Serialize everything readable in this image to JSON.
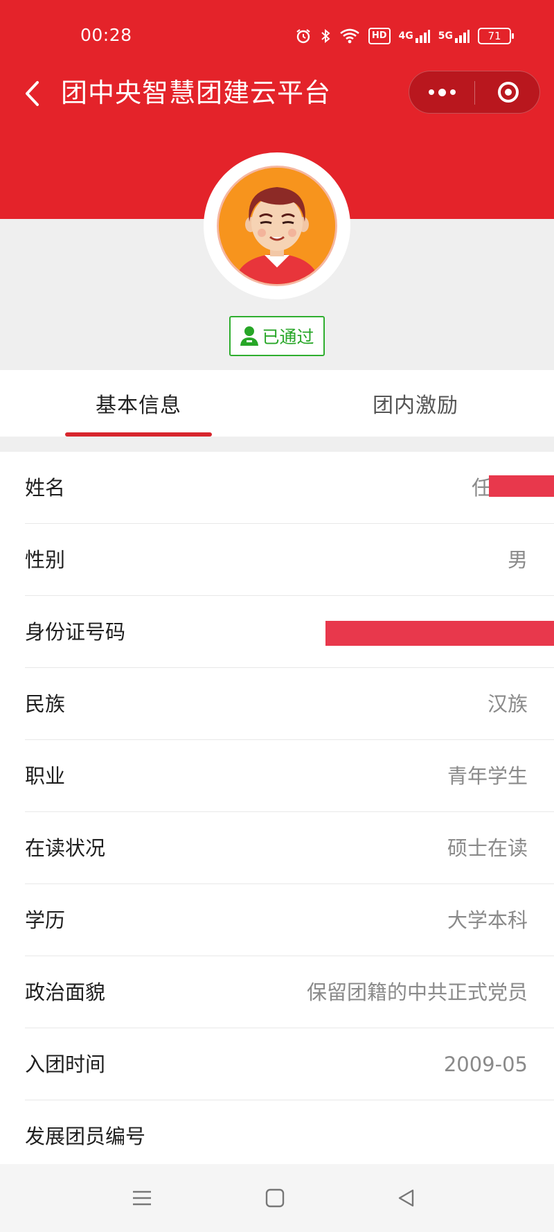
{
  "status_bar": {
    "time": "00:28",
    "hd_label": "HD",
    "network_1": "4G",
    "network_2": "5G",
    "battery": "71"
  },
  "nav": {
    "title": "团中央智慧团建云平台"
  },
  "profile": {
    "status_badge": "已通过"
  },
  "tabs": [
    {
      "label": "基本信息",
      "active": true
    },
    {
      "label": "团内激励",
      "active": false
    }
  ],
  "info": {
    "rows": [
      {
        "label": "姓名",
        "value": "任"
      },
      {
        "label": "性别",
        "value": "男"
      },
      {
        "label": "身份证号码",
        "value": ""
      },
      {
        "label": "民族",
        "value": "汉族"
      },
      {
        "label": "职业",
        "value": "青年学生"
      },
      {
        "label": "在读状况",
        "value": "硕士在读"
      },
      {
        "label": "学历",
        "value": "大学本科"
      },
      {
        "label": "政治面貌",
        "value": "保留团籍的中共正式党员"
      },
      {
        "label": "入团时间",
        "value": "2009-05"
      },
      {
        "label": "发展团员编号",
        "value": ""
      }
    ]
  },
  "colors": {
    "brand_red": "#e4232a",
    "approved_green": "#2eae2e",
    "tab_underline": "#d7262d",
    "redaction": "#e8384c"
  },
  "icons": {
    "back": "chevron-left-icon",
    "more": "more-dots-icon",
    "close": "target-close-icon",
    "approved": "person-badge-icon"
  }
}
